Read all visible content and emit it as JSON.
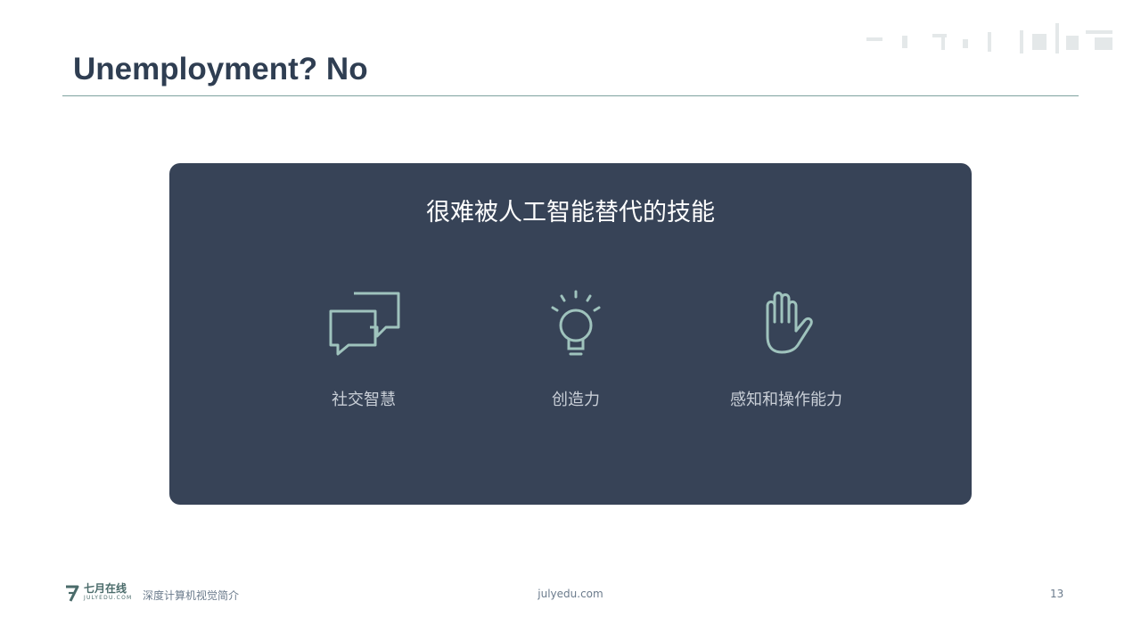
{
  "slide": {
    "title": "Unemployment?  No",
    "panel": {
      "heading": "很难被人工智能替代的技能",
      "skills": [
        {
          "label": "社交智慧",
          "icon": "chat-bubbles-icon"
        },
        {
          "label": "创造力",
          "icon": "lightbulb-icon"
        },
        {
          "label": "感知和操作能力",
          "icon": "hand-icon"
        }
      ]
    }
  },
  "footer": {
    "logo_cn": "七月在线",
    "logo_en": "JULYEDU.COM",
    "course": "深度计算机视觉简介",
    "url": "julyedu.com",
    "page_number": "13"
  },
  "colors": {
    "title": "#2f3e52",
    "rule": "#7fa3a0",
    "panel_bg": "#374357",
    "icon_stroke": "#9fc3bd",
    "skill_label": "#c9cfd7",
    "footer_text": "#6b7b8c"
  }
}
